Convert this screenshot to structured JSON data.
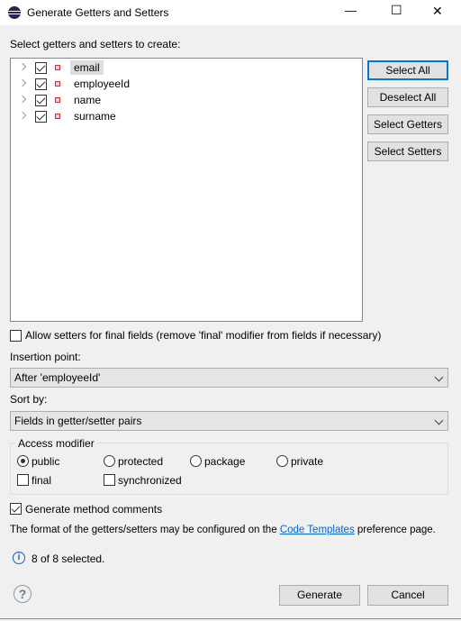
{
  "window": {
    "title": "Generate Getters and Setters",
    "icon": "eclipse-icon",
    "minimize": "—",
    "maximize": "☐",
    "close": "✕"
  },
  "tree": {
    "label": "Select getters and setters to create:",
    "items": [
      {
        "label": "email",
        "checked": true,
        "selected": true
      },
      {
        "label": "employeeId",
        "checked": true
      },
      {
        "label": "name",
        "checked": true
      },
      {
        "label": "surname",
        "checked": true
      }
    ]
  },
  "buttons": {
    "select_all": "Select All",
    "deselect_all": "Deselect All",
    "select_getters": "Select Getters",
    "select_setters": "Select Setters",
    "generate": "Generate",
    "cancel": "Cancel"
  },
  "allow_final": {
    "label": "Allow setters for final fields (remove 'final' modifier from fields if necessary)",
    "checked": false
  },
  "insertion": {
    "label": "Insertion point:",
    "value": "After 'employeeId'"
  },
  "sort": {
    "label": "Sort by:",
    "value": "Fields in getter/setter pairs"
  },
  "access": {
    "legend": "Access modifier",
    "radios": [
      "public",
      "protected",
      "package",
      "private"
    ],
    "selected": "public",
    "final": "final",
    "synchronized": "synchronized"
  },
  "comments": {
    "label": "Generate method comments",
    "checked": true
  },
  "format": {
    "before": "The format of the getters/setters may be configured on the ",
    "link": "Code Templates",
    "after": " preference page."
  },
  "status": "8 of 8 selected.",
  "colors": {
    "link": "#0066cc",
    "accent": "#0078d7"
  }
}
